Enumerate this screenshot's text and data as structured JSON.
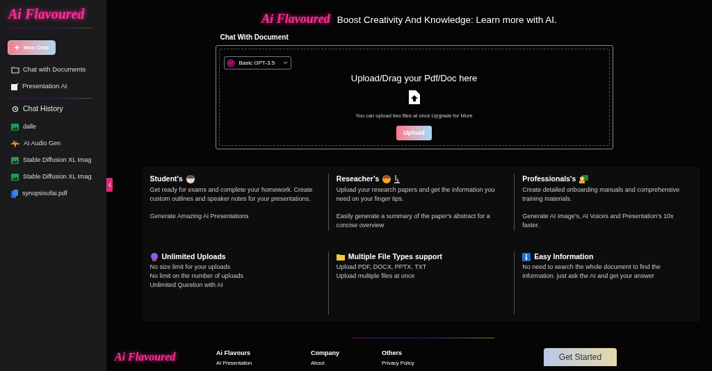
{
  "sidebar": {
    "logo": "Ai Flavoured",
    "new_chat": "New Chat",
    "nav": [
      {
        "label": "Chat with Documents",
        "kind": "folder"
      },
      {
        "label": "Presentation AI",
        "kind": "edit"
      }
    ],
    "history_title": "Chat History",
    "history": [
      {
        "label": "dalle",
        "kind": "image"
      },
      {
        "label": "AI Audio Gen",
        "kind": "audio"
      },
      {
        "label": "Stable Diffusion XL Imag",
        "kind": "image"
      },
      {
        "label": "Stable Diffusion XL Imag",
        "kind": "image"
      },
      {
        "label": "synopsisofai.pdf",
        "kind": "file"
      }
    ]
  },
  "header": {
    "logo": "Ai Flavoured",
    "tagline": "Boost Creativity And Knowledge: Learn more with AI."
  },
  "upload": {
    "title": "Chat With Document",
    "model": "Basic GPT-3.5",
    "heading": "Upload/Drag your Pdf/Doc here",
    "note": "You can upload two files at once.Upgrade for More",
    "button": "Upload"
  },
  "features": [
    {
      "title": "Student's",
      "kind": "student",
      "paragraphs": [
        "Get ready for exams and complete your homework. Create custom outlines and speaker notes for your presentations.",
        "Generate Amazing Ai Presentations"
      ]
    },
    {
      "title": "Reseacher's",
      "kind": "researcher",
      "paragraphs": [
        "Upload your research papers and get the information you need on your finger tips.",
        "Easily generate a summary of the paper's abstract for a concise overview"
      ]
    },
    {
      "title": "Professionals's",
      "kind": "professional",
      "paragraphs": [
        "Create detailed onboarding manuals and comprehensive training materials.",
        "Generate AI Image's, AI Voices and Presentation's 10x faster."
      ]
    },
    {
      "title": "Unlimited Uploads",
      "kind": "ball",
      "lines": [
        "No size limit for your uploads",
        "No limit on the number of uploads",
        "Unlimited Question with AI"
      ]
    },
    {
      "title": "Multiple File Types support",
      "kind": "folder",
      "lines": [
        "Upload PDF, DOCX, PPTX, TXT",
        "Upload multiple files at once"
      ]
    },
    {
      "title": "Easy Information",
      "kind": "info",
      "lines": [
        "No need to search the whole document to find the information. just ask the AI and get your answer"
      ]
    }
  ],
  "footer": {
    "logo": "Ai Flavoured",
    "columns": [
      {
        "title": "Ai Flavours",
        "links": [
          "AI Presentation"
        ]
      },
      {
        "title": "Company",
        "links": [
          "About"
        ]
      },
      {
        "title": "Others",
        "links": [
          "Privacy Policy"
        ]
      }
    ],
    "cta": "Get Started"
  }
}
